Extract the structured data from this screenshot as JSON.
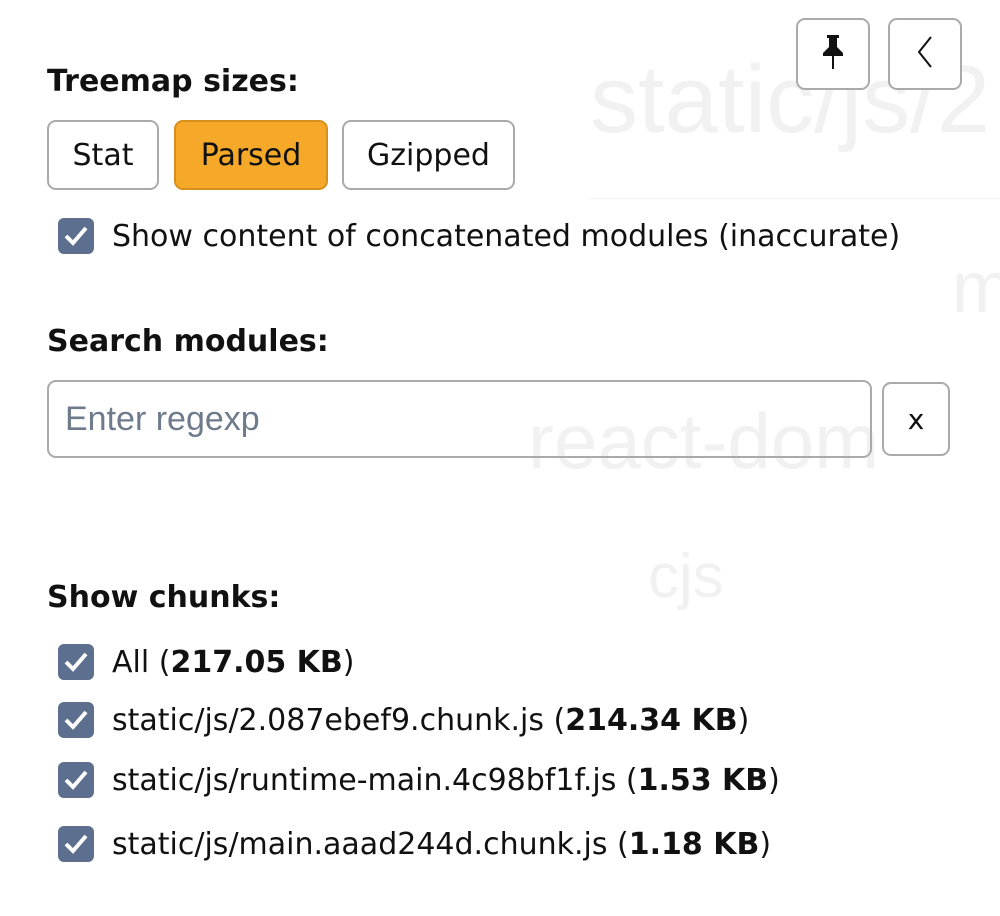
{
  "background_labels": [
    "static/js/2",
    "m",
    "react-dom",
    "cjs"
  ],
  "toolbar": {
    "pin_icon": "pin-icon",
    "back_icon": "chevron-left-icon"
  },
  "treemap_sizes": {
    "heading": "Treemap sizes:",
    "options": [
      "Stat",
      "Parsed",
      "Gzipped"
    ],
    "selected": "Parsed",
    "selected_color": "#f6a829"
  },
  "concatenated": {
    "label": "Show content of concatenated modules (inaccurate)",
    "checked": true
  },
  "search": {
    "heading": "Search modules:",
    "placeholder": "Enter regexp",
    "value": "",
    "clear_label": "x"
  },
  "chunks": {
    "heading": "Show chunks:",
    "items": [
      {
        "name": "All",
        "size": "217.05 KB",
        "checked": true
      },
      {
        "name": "static/js/2.087ebef9.chunk.js",
        "size": "214.34 KB",
        "checked": true
      },
      {
        "name": "static/js/runtime-main.4c98bf1f.js",
        "size": "1.53 KB",
        "checked": true
      },
      {
        "name": "static/js/main.aaad244d.chunk.js",
        "size": "1.18 KB",
        "checked": true
      }
    ]
  },
  "checkbox_color": "#5d6f8f"
}
